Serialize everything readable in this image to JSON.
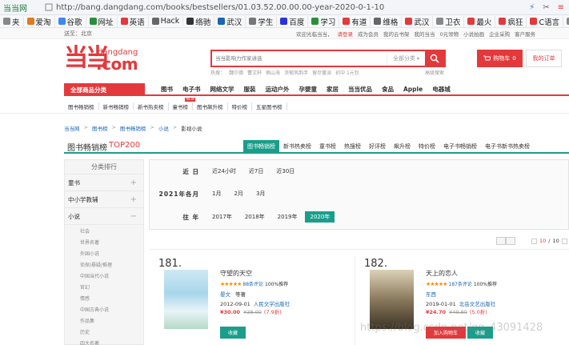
{
  "browser": {
    "tab_label": "当当网",
    "url": "http://bang.dangdang.com/books/bestsellers/01.03.52.00.00.00-year-2020-0-1-10",
    "bookmarks": [
      {
        "label": "夹",
        "color": "#888888"
      },
      {
        "label": "爱淘",
        "color": "#e07a20"
      },
      {
        "label": "谷歌",
        "color": "#4285f4"
      },
      {
        "label": "网址",
        "color": "#2a8f3a"
      },
      {
        "label": "英语",
        "color": "#e3393c"
      },
      {
        "label": "Hack",
        "color": "#666666"
      },
      {
        "label": "络驰",
        "color": "#333333"
      },
      {
        "label": "武汉",
        "color": "#1a66b3"
      },
      {
        "label": "学生",
        "color": "#777777"
      },
      {
        "label": "百度",
        "color": "#2932e1"
      },
      {
        "label": "学习",
        "color": "#2a8f3a"
      },
      {
        "label": "有道",
        "color": "#e3393c"
      },
      {
        "label": "维格",
        "color": "#666666"
      },
      {
        "label": "武汉",
        "color": "#e3393c"
      },
      {
        "label": "卫衣",
        "color": "#888888"
      },
      {
        "label": "最火",
        "color": "#e3393c"
      },
      {
        "label": "疯狂",
        "color": "#e3393c"
      },
      {
        "label": "C语言",
        "color": "#e3393c"
      },
      {
        "label": "叶鹤",
        "color": "#888888"
      },
      {
        "label": "jiesh",
        "color": "#333333"
      }
    ]
  },
  "topbar": {
    "location": "送至：北京",
    "links": [
      "欢迎光临当当，",
      "请登录",
      "成为会员",
      "我的云书架",
      "我的当当",
      "0元领物",
      "小说拍画",
      "企业采购",
      "客户服务"
    ]
  },
  "header": {
    "logo_mark": "当当",
    "logo_top": "dangdang",
    "logo_main": ".com",
    "search_placeholder": "当当影响力作家讲选",
    "search_category": "全部分类",
    "hot_keywords": [
      "热搜：",
      "魏尔德",
      "曹文轩",
      "佩山海",
      "浓郁风韵手",
      "留尽量派",
      "初中 1元包"
    ],
    "advanced": "高级搜索",
    "cart_label": "购物车",
    "cart_count": "0",
    "my_order": "我的订单"
  },
  "nav": {
    "all_categories": "全部商品分类",
    "main": [
      "图书",
      "电子书",
      "网络文学",
      "服装",
      "运动户外",
      "孕婴童",
      "家居",
      "当当优品",
      "食品",
      "Apple",
      "电器城"
    ],
    "sub": [
      "图书畅销榜",
      "新书畅销榜",
      "新书热卖榜",
      "童书榜",
      "图书飙升榜",
      "特价榜",
      "五星图书榜"
    ],
    "new_badge": "NEW"
  },
  "breadcrumb": [
    "当当网",
    "图书榜",
    "图书畅销榜",
    "小说",
    "影视小说"
  ],
  "ranking": {
    "title": "图书畅销榜",
    "top": "TOP200",
    "tabs": [
      "图书畅销榜",
      "新书热卖榜",
      "童书榜",
      "热搜榜",
      "好评榜",
      "飙升榜",
      "特价榜",
      "电子书畅销榜",
      "电子书新书热卖榜"
    ],
    "active_tab": 0
  },
  "sidebar": {
    "header": "分类排行",
    "categories": [
      {
        "label": "童书",
        "toggle": "+"
      },
      {
        "label": "中小学教辅",
        "toggle": "+"
      },
      {
        "label": "小说",
        "toggle": "−"
      }
    ],
    "subcategories": [
      "社会",
      "世界名著",
      "外国小说",
      "侦探/悬疑/推理",
      "中国当代小说",
      "官幻",
      "情感",
      "中国古典小说",
      "作品集",
      "历史",
      "四大名著"
    ]
  },
  "filter": {
    "rows": [
      {
        "label": "近 日",
        "options": [
          "近24小时",
          "近7日",
          "近30日"
        ],
        "active": -1
      },
      {
        "label": "2021年各月",
        "options": [
          "1月",
          "2月",
          "3月"
        ],
        "active": -1
      },
      {
        "label": "往 年",
        "options": [
          "2017年",
          "2018年",
          "2019年",
          "2020年"
        ],
        "active": 3
      }
    ]
  },
  "pager": {
    "current": "10",
    "total": "10"
  },
  "products": [
    {
      "rank": "181.",
      "title": "守望的天空",
      "stars": "★★★★★",
      "reviews": "88条评论",
      "recommend": "100%推荐",
      "author": "晏文",
      "author_extra": "等著",
      "date": "2012-09-01",
      "publisher": "人民文学出版社",
      "price": "¥30.00",
      "old_price": "¥38.00",
      "discount": "(7.9折)",
      "buttons": [
        "收藏"
      ]
    },
    {
      "rank": "182.",
      "title": "天上的恋人",
      "stars": "★★★★★",
      "reviews": "187条评论",
      "recommend": "100%推荐",
      "author": "东西",
      "author_extra": "",
      "date": "2019-01-01",
      "publisher": "北岳文艺出版社",
      "price": "¥24.70",
      "old_price": "¥49.80",
      "discount": "(5.0折)",
      "buttons": [
        "加入购物车",
        "收藏"
      ]
    }
  ],
  "watermark": "https://blog.csdn.net/qq_43091428"
}
